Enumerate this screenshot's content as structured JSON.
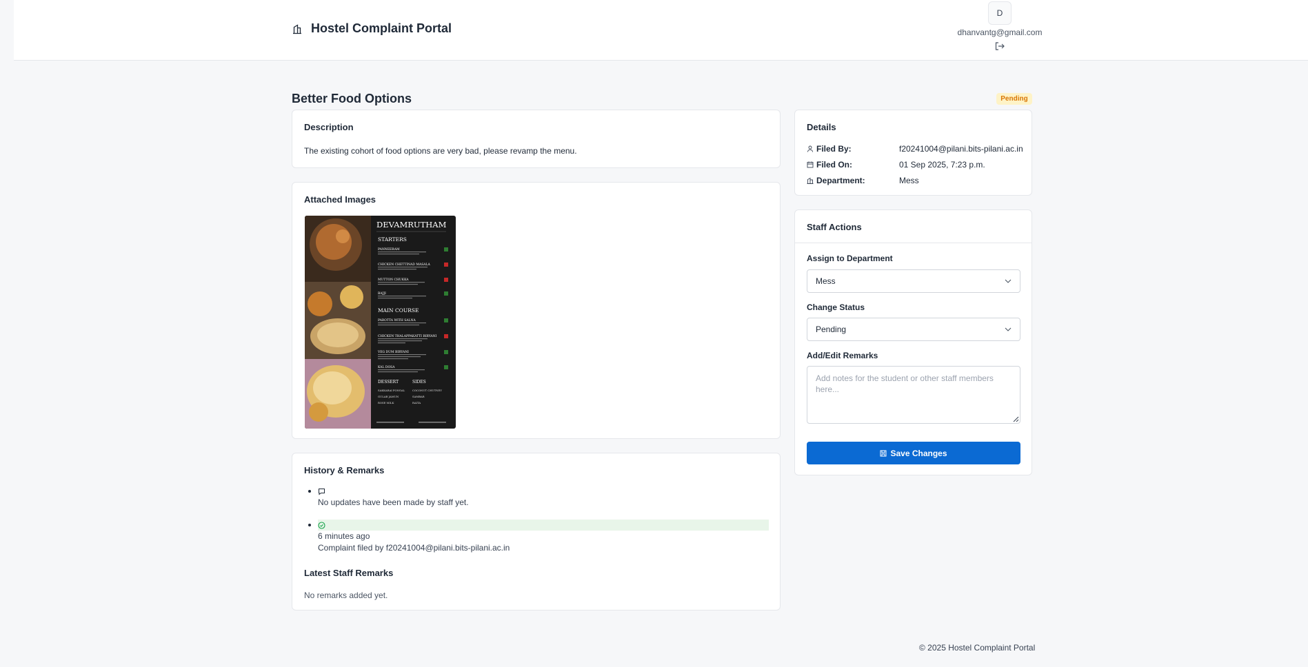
{
  "header": {
    "title": "Hostel Complaint Portal",
    "avatar_initial": "D",
    "user_email": "dhanvantg@gmail.com"
  },
  "complaint": {
    "title": "Better Food Options",
    "status": "Pending"
  },
  "description": {
    "heading": "Description",
    "text": "The existing cohort of food options are very bad, please revamp the menu."
  },
  "attachments": {
    "heading": "Attached Images",
    "menu_image": {
      "restaurant": "DEVAMRUTHAM",
      "starters_heading": "STARTERS",
      "starters": [
        "PANNEERAM",
        "CHICKEN CHETTINAD MASALA",
        "MUTTON CHUKKA",
        "BAJJI"
      ],
      "main_heading": "MAIN COURSE",
      "main_course": [
        "PAROTTA WITH SALNA",
        "CHICKEN THALAPPAKATTI BIRYANI",
        "VEG DUM BIRYANI",
        "KAL DOSA"
      ],
      "dessert_heading": "DESSERT",
      "desserts": [
        "SAKKARAI PONGAL",
        "GULAB JAMUN",
        "ROSE MILK"
      ],
      "sides_heading": "SIDES",
      "sides": [
        "COCONUT CHUTNEY",
        "SAMBAR",
        "RAITA"
      ]
    }
  },
  "history": {
    "heading": "History & Remarks",
    "items": [
      {
        "icon": "chat-bubble-icon",
        "lines": [
          "No updates have been made by staff yet."
        ]
      },
      {
        "icon": "check-circle-icon",
        "lines": [
          "6 minutes ago",
          "Complaint filed by f20241004@pilani.bits-pilani.ac.in"
        ]
      }
    ],
    "latest_heading": "Latest Staff Remarks",
    "latest_text": "No remarks added yet."
  },
  "details": {
    "heading": "Details",
    "filed_by_label": "Filed By:",
    "filed_by": "f20241004@pilani.bits-pilani.ac.in",
    "filed_on_label": "Filed On:",
    "filed_on": "01 Sep 2025, 7:23 p.m.",
    "department_label": "Department:",
    "department": "Mess"
  },
  "staff_actions": {
    "heading": "Staff Actions",
    "assign_label": "Assign to Department",
    "assign_value": "Mess",
    "status_label": "Change Status",
    "status_value": "Pending",
    "remarks_label": "Add/Edit Remarks",
    "remarks_placeholder": "Add notes for the student or other staff members here...",
    "save_label": "Save Changes"
  },
  "footer": {
    "text": "© 2025 Hostel Complaint Portal"
  },
  "colors": {
    "primary": "#0b6ad3",
    "pending_badge_bg": "#fef3c7",
    "pending_badge_text": "#d97706",
    "success_bg": "#e8f5e9",
    "success_icon": "#16a34a"
  }
}
